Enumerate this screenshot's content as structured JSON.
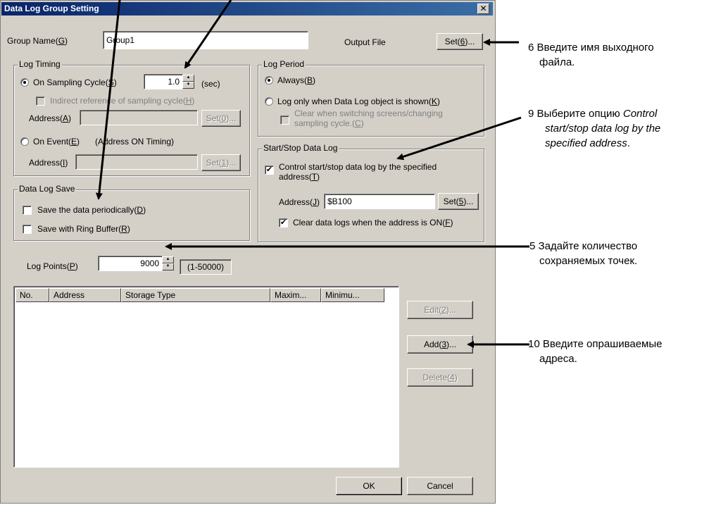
{
  "dialog": {
    "title": "Data Log Group Setting",
    "close_glyph": "✕",
    "group_name_label_pre": "Group Name(",
    "group_name_key": "G",
    "group_name_label_post": ")",
    "group_name_value": "Group1",
    "output_file_label": "Output File",
    "set6_pre": "Set(",
    "set6_key": "6",
    "set6_post": ")..."
  },
  "log_timing": {
    "legend": "Log Timing",
    "on_sampling_pre": "On Sampling Cycle(",
    "on_sampling_key": "S",
    "on_sampling_post": ")",
    "sampling_value": "1.0",
    "sec_label": "(sec)",
    "indirect_pre": "Indirect reference of sampling cycle(",
    "indirect_key": "H",
    "indirect_post": ")",
    "address_a_pre": "Address(",
    "address_a_key": "A",
    "address_a_post": ")",
    "set0_pre": "Set(",
    "set0_key": "0",
    "set0_post": ")...",
    "on_event_pre": "On Event(",
    "on_event_key": "E",
    "on_event_post": ")",
    "address_on_timing": "(Address ON Timing)",
    "address_i_pre": "Address(",
    "address_i_key": "I",
    "address_i_post": ")",
    "set1_pre": "Set(",
    "set1_key": "1",
    "set1_post": ")..."
  },
  "log_period": {
    "legend": "Log Period",
    "always_pre": "Always(",
    "always_key": "B",
    "always_post": ")",
    "only_shown_pre": "Log only when Data Log object is shown(",
    "only_shown_key": "K",
    "only_shown_post": ")",
    "clear_line1": "Clear when switching screens/changing",
    "clear_line2_pre": "sampling cycle.(",
    "clear_line2_key": "C",
    "clear_line2_post": ")"
  },
  "start_stop": {
    "legend": "Start/Stop Data Log",
    "control_line1": "Control start/stop data log by the specified",
    "control_line2_pre": "address(",
    "control_line2_key": "T",
    "control_line2_post": ")",
    "address_j_pre": "Address(",
    "address_j_key": "J",
    "address_j_post": ")",
    "address_j_value": "$B100",
    "set5_pre": "Set(",
    "set5_key": "5",
    "set5_post": ")...",
    "clear_on_pre": "Clear data logs when the address is ON(",
    "clear_on_key": "F",
    "clear_on_post": ")",
    "check_glyph": "✔"
  },
  "data_log_save": {
    "legend": "Data Log Save",
    "periodic_pre": "Save the data periodically(",
    "periodic_key": "D",
    "periodic_post": ")",
    "ring_pre": "Save with Ring Buffer(",
    "ring_key": "R",
    "ring_post": ")"
  },
  "log_points": {
    "label_pre": "Log Points(",
    "label_key": "P",
    "label_post": ")",
    "value": "9000",
    "range": "(1-50000)"
  },
  "table": {
    "columns": [
      "No.",
      "Address",
      "Storage Type",
      "Maxim...",
      "Minimu..."
    ],
    "rows": []
  },
  "buttons": {
    "edit_pre": "Edit(",
    "edit_key": "2",
    "edit_post": ")...",
    "add_pre": "Add(",
    "add_key": "3",
    "add_post": ")...",
    "delete_pre": "Delete(",
    "delete_key": "4",
    "delete_post": ")",
    "ok": "OK",
    "cancel": "Cancel"
  },
  "annotations": {
    "a6_line1": "6 Введите имя выходного",
    "a6_line2": "файла.",
    "a9_line1_pre": "9 Выберите опцию ",
    "a9_line1_em": "Control",
    "a9_line2": "start/stop data log by the",
    "a9_line3_em": "specified address",
    "a9_line3_post": ".",
    "a5_line1": "5 Задайте количество",
    "a5_line2": "сохраняемых точек.",
    "a10_line1": "10 Введите опрашиваемые",
    "a10_line2": "адреса."
  },
  "icons": {
    "arrow_up": "▲",
    "arrow_down": "▼"
  }
}
